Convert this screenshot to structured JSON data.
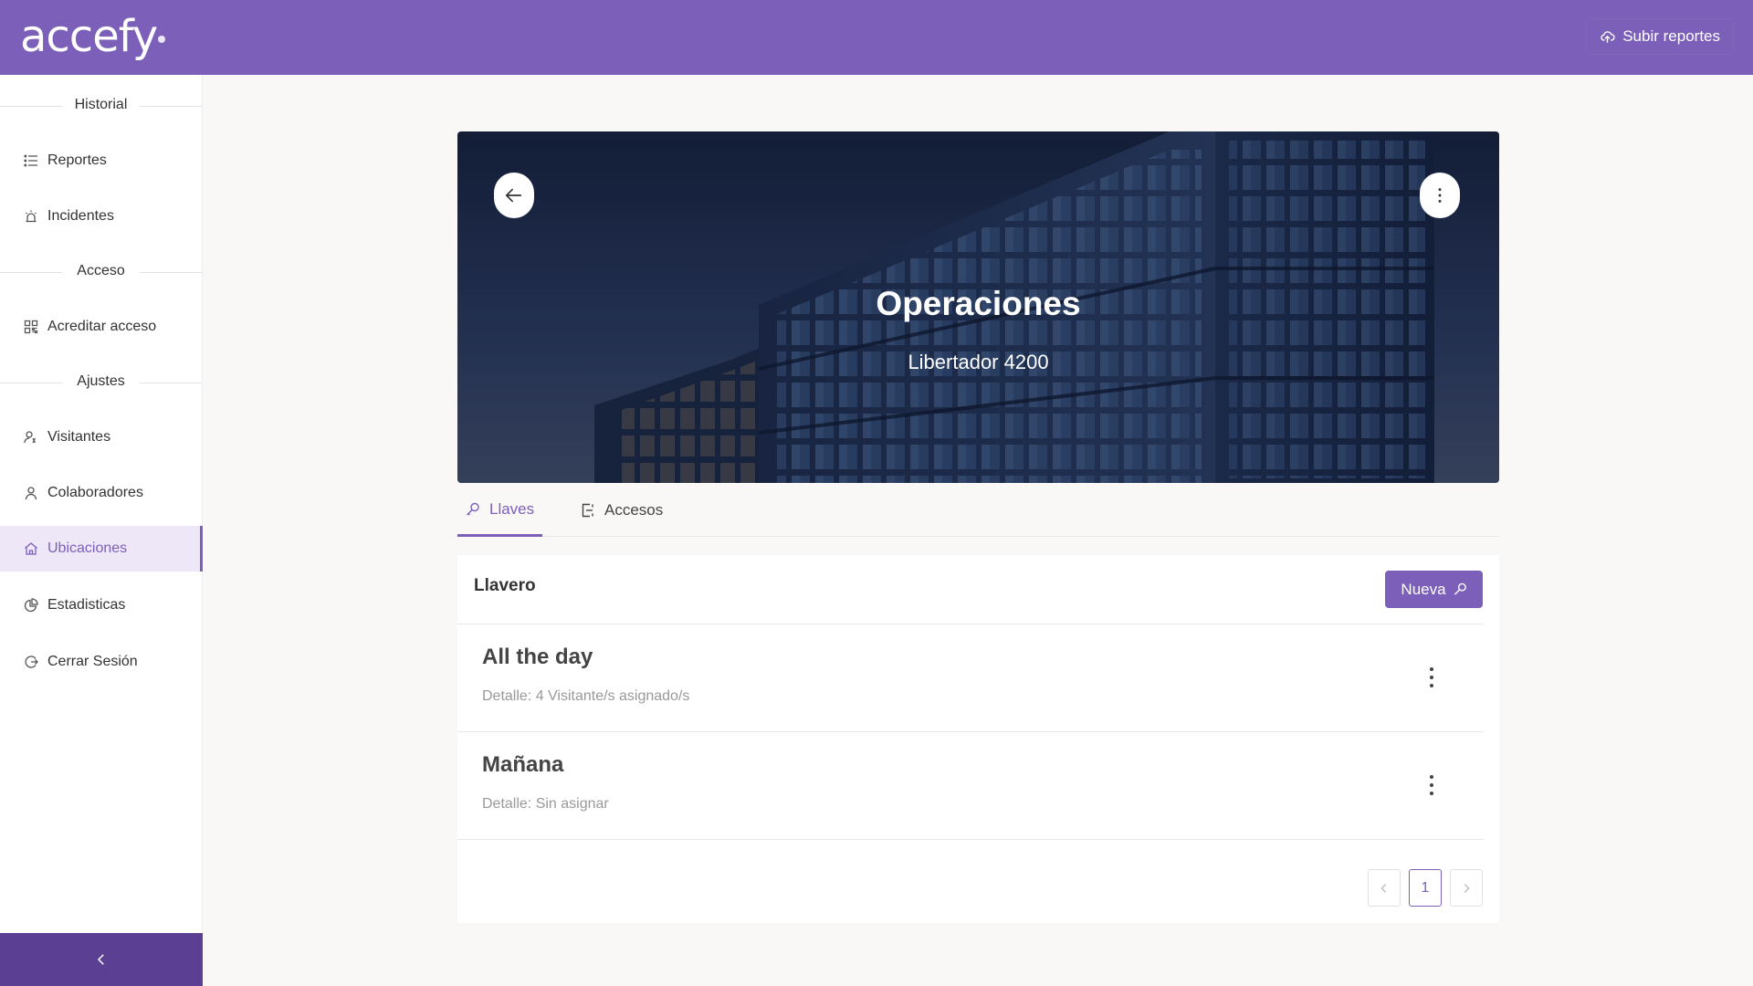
{
  "header": {
    "logo": "accefy",
    "upload_label": "Subir reportes"
  },
  "sidebar": {
    "sections": [
      {
        "label": "Historial"
      },
      {
        "label": "Acceso"
      },
      {
        "label": "Ajustes"
      }
    ],
    "items": [
      {
        "label": "Reportes",
        "icon": "list-icon"
      },
      {
        "label": "Incidentes",
        "icon": "alarm-icon"
      },
      {
        "label": "Acreditar acceso",
        "icon": "qr-code-icon"
      },
      {
        "label": "Visitantes",
        "icon": "visitor-icon"
      },
      {
        "label": "Colaboradores",
        "icon": "user-icon"
      },
      {
        "label": "Ubicaciones",
        "icon": "home-icon",
        "active": true
      },
      {
        "label": "Estadisticas",
        "icon": "pie-chart-icon"
      },
      {
        "label": "Cerrar Sesión",
        "icon": "logout-icon"
      }
    ]
  },
  "location": {
    "name": "Operaciones",
    "address": "Libertador 4200"
  },
  "tabs": [
    {
      "label": "Llaves",
      "icon": "key-icon",
      "active": true
    },
    {
      "label": "Accesos",
      "icon": "door-icon",
      "active": false
    }
  ],
  "keyring": {
    "title": "Llavero",
    "new_label": "Nueva",
    "items": [
      {
        "title": "All the day",
        "detail": "Detalle: 4 Visitante/s asignado/s"
      },
      {
        "title": "Mañana",
        "detail": "Detalle: Sin asignar"
      }
    ],
    "pagination": {
      "current_page": "1"
    }
  },
  "colors": {
    "brand": "#7c5fb9",
    "brand_dark": "#5b3f93",
    "active_bg": "#eee7f8",
    "page_bg": "#faf8f7"
  }
}
